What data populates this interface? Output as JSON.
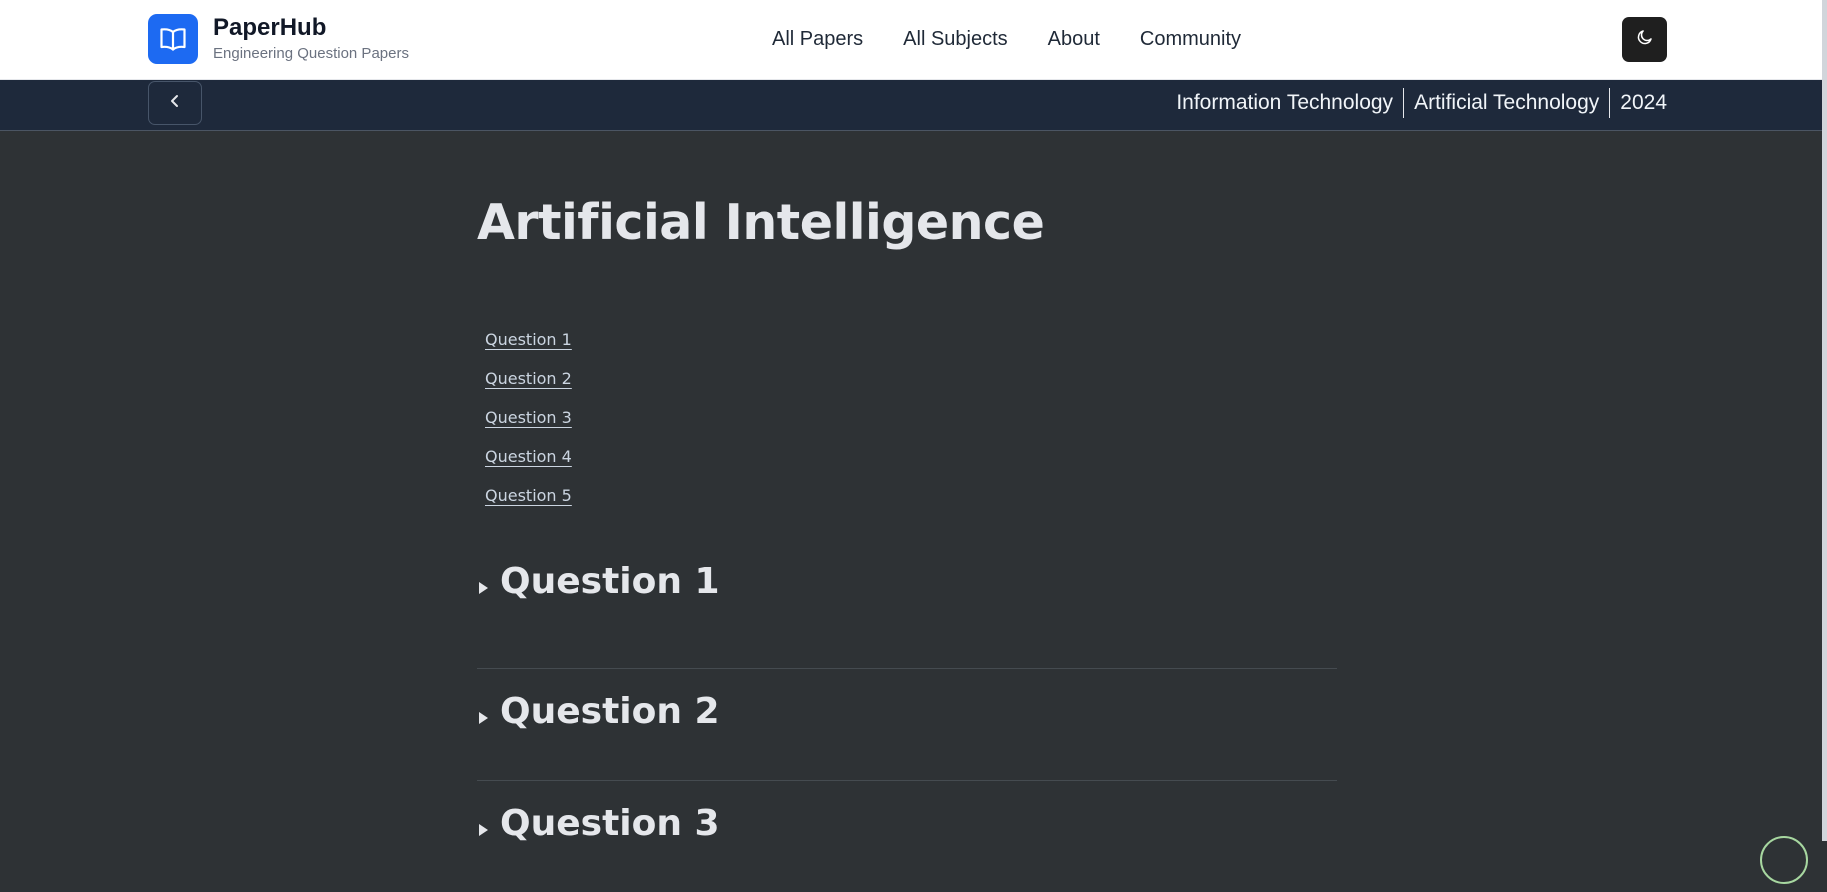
{
  "header": {
    "brand_title": "PaperHub",
    "brand_subtitle": "Engineering Question Papers",
    "logo_icon": "open-book-icon",
    "nav": [
      {
        "label": "All Papers"
      },
      {
        "label": "All Subjects"
      },
      {
        "label": "About"
      },
      {
        "label": "Community"
      }
    ],
    "theme_icon": "moon-icon"
  },
  "subbar": {
    "back_icon": "chevron-left-icon",
    "breadcrumbs": [
      {
        "label": "Information Technology"
      },
      {
        "label": "Artificial Technology"
      },
      {
        "label": "2024"
      }
    ]
  },
  "main": {
    "title": "Artificial Intelligence",
    "toc": [
      {
        "label": "Question 1"
      },
      {
        "label": "Question 2"
      },
      {
        "label": "Question 3"
      },
      {
        "label": "Question 4"
      },
      {
        "label": "Question 5"
      }
    ],
    "questions": [
      {
        "title": "Question 1"
      },
      {
        "title": "Question 2"
      },
      {
        "title": "Question 3"
      }
    ]
  },
  "colors": {
    "brand_blue": "#1d6af2",
    "page_background": "#2e3235",
    "subbar_background": "#1e293b"
  }
}
